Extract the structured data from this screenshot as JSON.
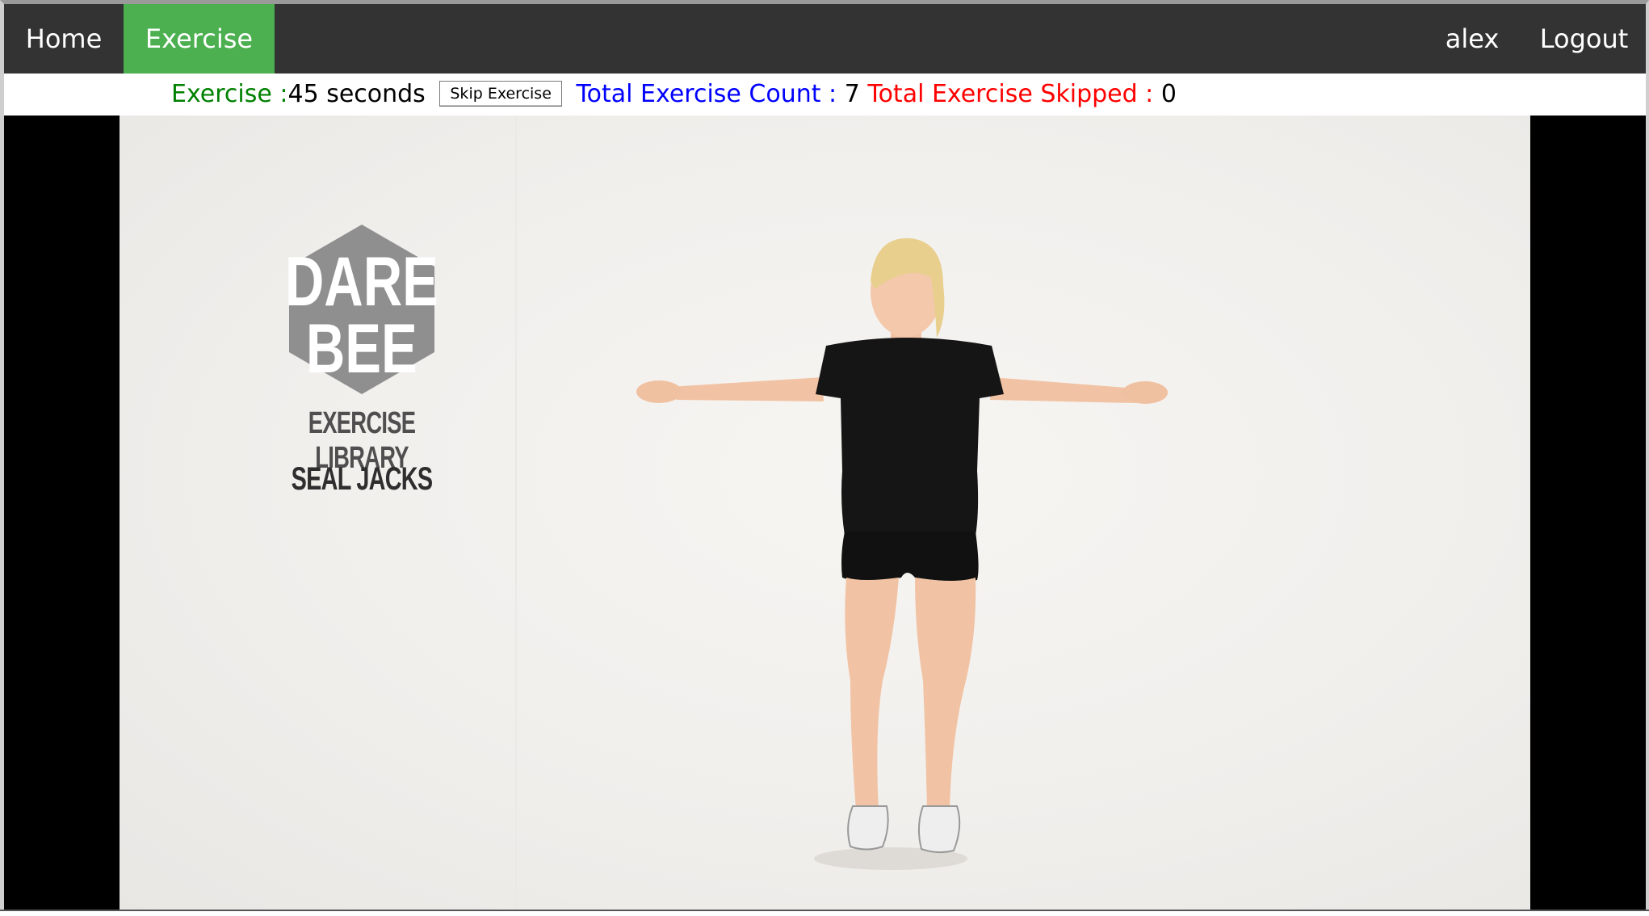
{
  "nav": {
    "home": "Home",
    "exercise": "Exercise",
    "user": "alex",
    "logout": "Logout"
  },
  "status": {
    "exercise_label": "Exercise :",
    "exercise_time": "45 seconds",
    "skip_button": "Skip Exercise",
    "count_label": "Total Exercise Count :",
    "count_value": "7",
    "skipped_label": "Total Exercise Skipped :",
    "skipped_value": "0"
  },
  "video": {
    "logo_line1": "DARE",
    "logo_line2": "BEE",
    "library_title": "EXERCISE LIBRARY",
    "exercise_name": "SEAL JACKS"
  },
  "colors": {
    "nav_bg": "#333333",
    "nav_active": "#4caf50",
    "label_green": "#008000",
    "label_blue": "#0000ff",
    "label_red": "#ff0000"
  }
}
